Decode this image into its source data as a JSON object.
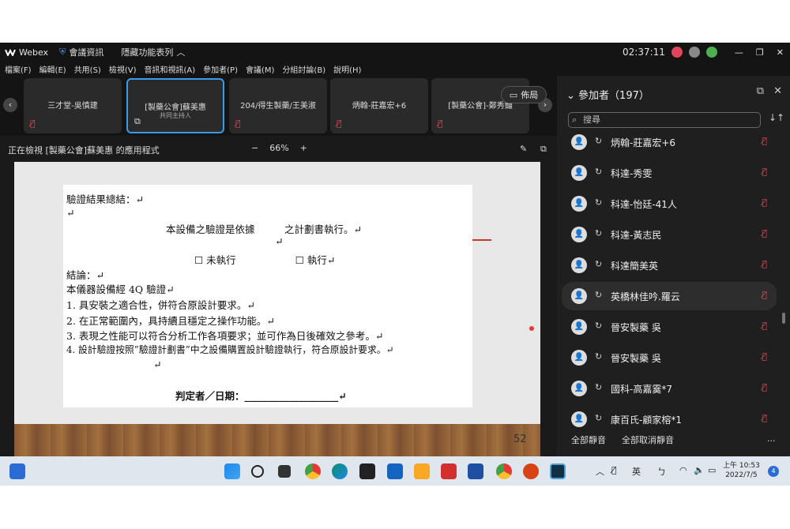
{
  "titlebar": {
    "app": "Webex",
    "meeting_info": "會議資訊",
    "hide_menu": "隱藏功能表列",
    "time": "02:37:11"
  },
  "menu": [
    "檔案(F)",
    "編輯(E)",
    "共用(S)",
    "檢視(V)",
    "音訊和視訊(A)",
    "參加者(P)",
    "會議(M)",
    "分組討論(B)",
    "說明(H)"
  ],
  "tiles": [
    {
      "name": "三才堂-吳慎建",
      "sub": ""
    },
    {
      "name": "[製藥公會]蘇美惠",
      "sub": "共同主持人"
    },
    {
      "name": "204/得生製藥/王美淑",
      "sub": ""
    },
    {
      "name": "炳翰-莊嘉宏+6",
      "sub": ""
    },
    {
      "name": "[製藥公會]-鄭秀豔",
      "sub": ""
    }
  ],
  "layout_button": "佈局",
  "share": {
    "viewing": "正在檢視 [製藥公會]蘇美惠 的應用程式",
    "zoom_out": "−",
    "zoom": "66%",
    "zoom_in": "+"
  },
  "document": {
    "lines": [
      "驗證結果總結：↵",
      "↵",
      "本設備之驗證是依據　　　之計劃書執行。↵",
      "↵",
      "☐  未執行　　　　　　☐  執行↵",
      "結論：↵",
      "本儀器設備經 4Q 驗證↵",
      "1. 具安裝之適合性，併符合原設計要求。↵",
      "2. 在正常範圍內，具持續且穩定之操作功能。↵",
      "3. 表現之性能可以符合分析工作各項要求；並可作為日後確效之參考。↵",
      "4. 設計驗證按照”驗證計劃書”中之設備購置設計驗證執行，符合原設計要求。↵",
      "↵",
      "判定者／日期：___________________↵"
    ],
    "page_number": "52"
  },
  "participants": {
    "header": "參加者（197）",
    "search_placeholder": "搜尋",
    "list": [
      "炳翰-莊嘉宏+6",
      "科達-秀雯",
      "科達-怡廷-41人",
      "科達-黃志民",
      "科達簡美英",
      "英橋林佳吟.羅云",
      "晉安製藥 吳",
      "晉安製藥 吳",
      "國科-高嘉霙*7",
      "康百氏-顧家榕*1"
    ],
    "mute_all": "全部靜音",
    "unmute_all": "全部取消靜音",
    "more": "..."
  },
  "taskbar": {
    "ime": "英",
    "time": "上午 10:53",
    "date": "2022/7/5",
    "notifications": "4"
  },
  "colors": {
    "accent": "#3b9be8",
    "muted": "#e0455c",
    "bg": "#1a1a1a"
  }
}
